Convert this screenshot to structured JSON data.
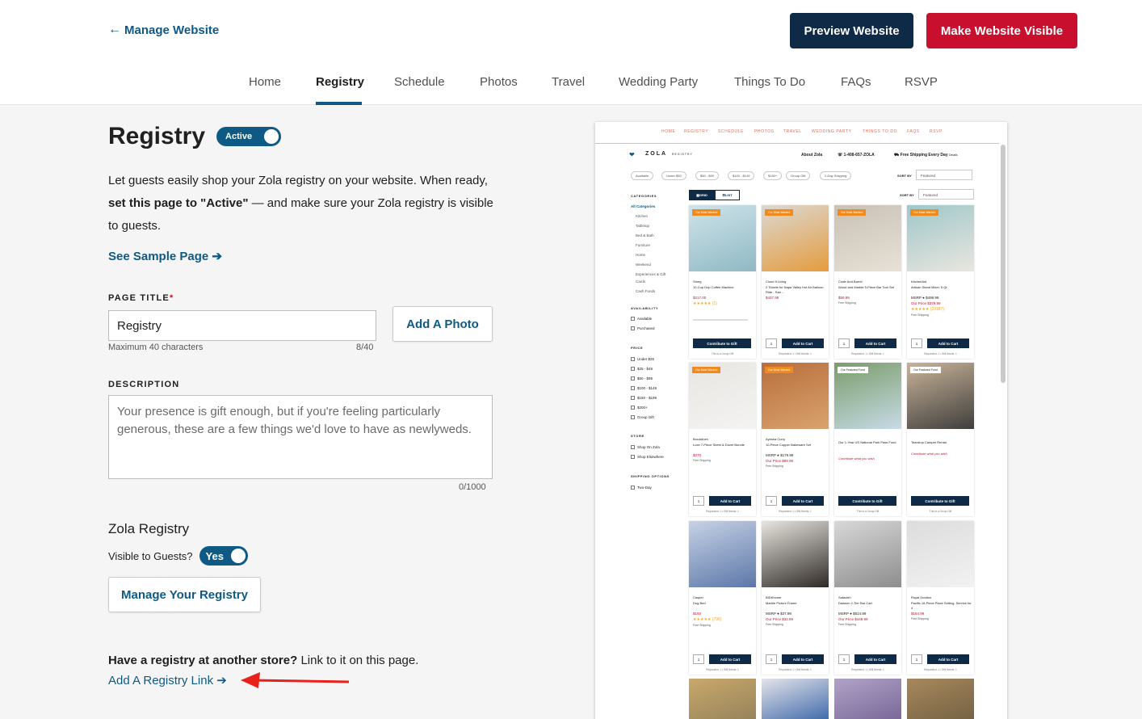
{
  "header": {
    "back_label": "Manage Website",
    "preview_label": "Preview Website",
    "visible_label": "Make Website Visible",
    "nav": [
      "Home",
      "Registry",
      "Schedule",
      "Photos",
      "Travel",
      "Wedding Party",
      "Things To Do",
      "FAQs",
      "RSVP"
    ],
    "nav_active": "Registry"
  },
  "page": {
    "title": "Registry",
    "status_label": "Active",
    "intro_1": "Let guests easily shop your Zola registry on your website. When ready,",
    "intro_bold": "set this page to \"Active\"",
    "intro_2": "— and make sure your Zola registry is visible to guests.",
    "sample_link": "See Sample Page",
    "page_title_label": "PAGE TITLE",
    "page_title_value": "Registry",
    "max_chars_hint": "Maximum 40 characters",
    "title_count": "8/40",
    "add_photo_label": "Add A Photo",
    "description_label": "DESCRIPTION",
    "description_value": "Your presence is gift enough, but if you're feeling particularly generous, these are a few things we'd love to have as newlyweds.",
    "description_count": "0/1000",
    "zola_heading": "Zola Registry",
    "visible_label": "Visible to Guests?",
    "visible_toggle": "Yes",
    "manage_label": "Manage Your Registry",
    "other_store_bold": "Have a registry at another store?",
    "other_store_rest": "Link to it on this page.",
    "add_link_label": "Add A Registry Link"
  },
  "preview": {
    "nav": [
      "HOME",
      "REGISTRY",
      "SCHEDULE",
      "PHOTOS",
      "TRAVEL",
      "WEDDING PARTY",
      "THINGS TO DO",
      "FAQS",
      "RSVP"
    ],
    "logo": "ZOLA",
    "logo_sub": "REGISTRY",
    "about": "About Zola",
    "phone": "1-408-657-ZOLA",
    "shipping": "Free Shipping Every Day",
    "shipping_details": "Details",
    "chips": [
      "Available",
      "Under $50",
      "$50 - $99",
      "$100 - $149",
      "$150+",
      "Group Gift",
      "2-Day Shipping"
    ],
    "sort_by": "SORT BY",
    "sort_value": "Featured",
    "grid_label": "GRID",
    "list_label": "LIST",
    "sidebar": {
      "categories_h": "CATEGORIES",
      "all_categories": "All Categories",
      "categories": [
        "Kitchen",
        "Tabletop",
        "Bed & Bath",
        "Furniture",
        "Home",
        "Weekend",
        "Experiences & Gift",
        "Cards",
        "Cash Funds"
      ],
      "availability_h": "AVAILABILITY",
      "availability": [
        "Available",
        "Purchased"
      ],
      "price_h": "PRICE",
      "price": [
        "Under $25",
        "$25 - $49",
        "$50 - $99",
        "$100 - $149",
        "$150 - $199",
        "$200+",
        "Group Gift"
      ],
      "store_h": "STORE",
      "store": [
        "Shop On Zola",
        "Shop Elsewhere"
      ],
      "shipping_h": "SHIPPING OPTIONS",
      "shipping": [
        "Two-Day"
      ]
    },
    "badge_wanted": "Our Most Wanted",
    "badge_fund": "Our Featured Fund",
    "add_to_cart": "Add to Cart",
    "contribute": "Contribute to Gift",
    "contribute_what": "Contribute what you wish",
    "requested": "Requested: 1 • Still Needs: 1",
    "group_gift": "This is a Group Gift",
    "free_shipping": "Free Shipping",
    "qty": "1",
    "products": [
      {
        "brand": "Smeg",
        "name": "10-Cup Drip Coffee Machine",
        "price": "$217.00",
        "stars": "★★★★★",
        "rating": "(1)",
        "type": "contribute"
      },
      {
        "brand": "Cloud 9 Living",
        "name": "2 Tickets for Napa Valley Hot Air Balloon Ride - San ...",
        "price": "$437.99",
        "type": "cart"
      },
      {
        "brand": "Crate And Barrel",
        "name": "Wood and Marble 5-Piece Bar Tool Set",
        "price": "$59.99",
        "type": "cart"
      },
      {
        "brand": "KitchenAid",
        "name": "Artisan Stand Mixer, 5 Qt",
        "msrp": "MSRP ● $499.99",
        "our": "Our Price $379.99",
        "stars": "★★★★★",
        "rating": "(23187)",
        "type": "cart"
      },
      {
        "brand": "Brooklinen",
        "name": "Luxe 7-Piece Sheet & Duvet Bundle",
        "price": "$270",
        "type": "cart"
      },
      {
        "brand": "Ayesha Curry",
        "name": "10-Piece Copper Bakeware Set",
        "msrp": "MSRP ● $179.99",
        "our": "Our Price $89.99",
        "type": "cart"
      },
      {
        "brand": "",
        "name": "Our 1-Year US National Park Pass Fund",
        "type": "fund"
      },
      {
        "brand": "",
        "name": "Teardrop Camper Rental",
        "type": "fund"
      },
      {
        "brand": "Casper",
        "name": "Dog Bed",
        "price": "$150",
        "stars": "★★★★★",
        "rating": "(796)",
        "type": "cart"
      },
      {
        "brand": "BIDKhome",
        "name": "Marble Picture Frame",
        "msrp": "MSRP ● $37.99",
        "our": "Our Price $32.99",
        "type": "cart"
      },
      {
        "brand": "Safavieh",
        "name": "Dawson 2-Tier Bar Cart",
        "msrp": "MSRP ● $514.99",
        "our": "Our Price $449.99",
        "type": "cart"
      },
      {
        "brand": "Royal Doulton",
        "name": "Pacific 16-Piece Place Setting, Service for 4",
        "price": "$164.99",
        "type": "cart"
      }
    ]
  },
  "colors": {
    "accent": "#0e5a85",
    "navy": "#0e2a47",
    "brand_red": "#c8102e",
    "badge_orange": "#f18a1c"
  }
}
